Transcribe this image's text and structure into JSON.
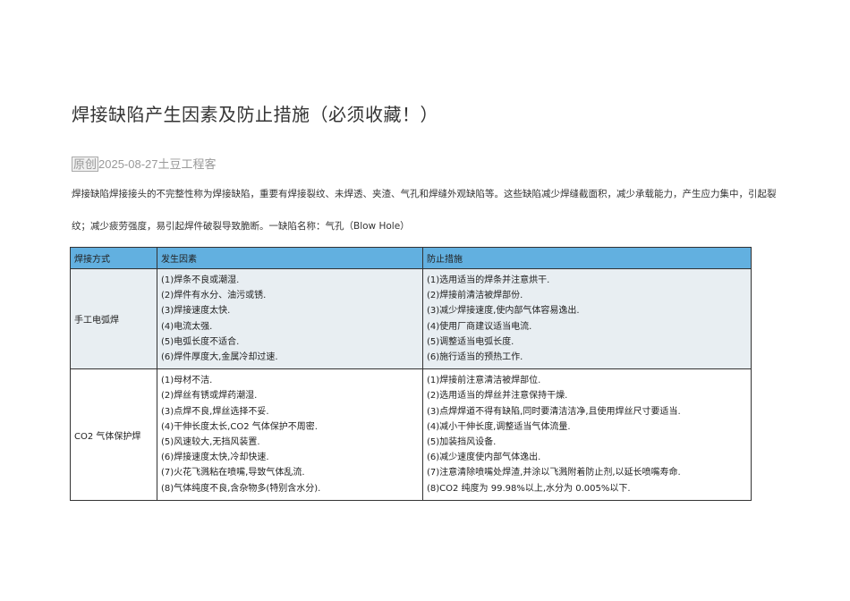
{
  "title": "焊接缺陷产生因素及防止措施（必须收藏！）",
  "meta": {
    "tag": "原创",
    "date": "2025-08-27",
    "author": "土豆工程客"
  },
  "intro": "焊接缺陷焊接接头的不完整性称为焊接缺陷，重要有焊接裂纹、未焊透、夹渣、气孔和焊缝外观缺陷等。这些缺陷减少焊缝截面积，减少承载能力，产生应力集中，引起裂纹；减少疲劳强度，易引起焊件破裂导致脆断。一缺陷名称：气孔（Blow Hole）",
  "table": {
    "headers": [
      "焊接方式",
      "发生因素",
      "防止措施"
    ],
    "rows": [
      {
        "method": "手工电弧焊",
        "causes": [
          "(1)焊条不良或潮湿.",
          "(2)焊件有水分、油污或锈.",
          "(3)焊接速度太快.",
          "(4)电流太强.",
          "(5)电弧长度不适合.",
          "(6)焊件厚度大,金属冷却过速."
        ],
        "measures": [
          "(1)选用适当的焊条并注意烘干.",
          "(2)焊接前清洁被焊部份.",
          "(3)减少焊接速度,使内部气体容易逸出.",
          "(4)使用厂商建议适当电流.",
          "(5)调整适当电弧长度.",
          "(6)施行适当的预热工作."
        ]
      },
      {
        "method": "CO2 气体保护焊",
        "causes": [
          "(1)母材不洁.",
          "(2)焊丝有锈或焊药潮湿.",
          "(3)点焊不良,焊丝选择不妥.",
          "(4)干伸长度太长,CO2 气体保护不周密.",
          "(5)风速较大,无挡风装置.",
          "(6)焊接速度太快,冷却快速.",
          "(7)火花飞溅粘在喷嘴,导致气体乱流.",
          "(8)气体纯度不良,含杂物多(特别含水分)."
        ],
        "measures": [
          "(1)焊接前注意清洁被焊部位.",
          "(2)选用适当的焊丝并注意保持干燥.",
          "(3)点焊焊道不得有缺陷,同时要清洁洁净,且使用焊丝尺寸要适当.",
          "(4)减小干伸长度,调整适当气体流量.",
          "(5)加装挡风设备.",
          "(6)减少速度使内部气体逸出.",
          "(7)注意清除喷嘴处焊渣,并涂以飞溅附着防止剂,以延长喷嘴寿命.",
          "(8)CO2 纯度为 99.98%以上,水分为 0.005%以下."
        ]
      }
    ]
  }
}
